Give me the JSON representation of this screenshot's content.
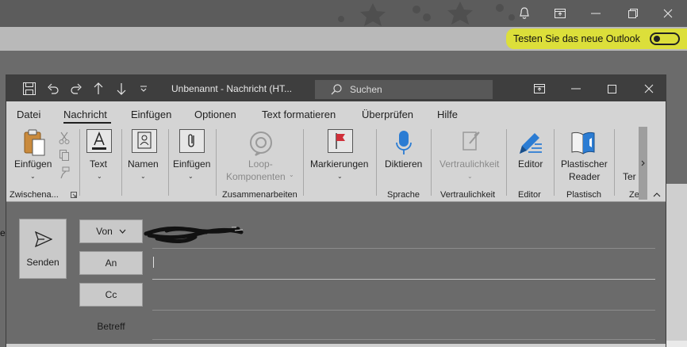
{
  "background_window": {
    "promo_text": "Testen Sie das neue Outlook",
    "left_clipped_char": "e"
  },
  "compose": {
    "title": "Unbenannt  -  Nachricht (HT...",
    "search_placeholder": "Suchen",
    "tabs": [
      {
        "label": "Datei"
      },
      {
        "label": "Nachricht",
        "active": true
      },
      {
        "label": "Einfügen"
      },
      {
        "label": "Optionen"
      },
      {
        "label": "Text formatieren"
      },
      {
        "label": "Überprüfen"
      },
      {
        "label": "Hilfe"
      }
    ],
    "ribbon": {
      "paste": "Einfügen",
      "text": "Text",
      "names": "Namen",
      "insert": "Einfügen",
      "loop_line1": "Loop-",
      "loop_line2": "Komponenten",
      "tags": "Markierungen",
      "dictate": "Diktieren",
      "sensitivity": "Vertraulichkeit",
      "editor": "Editor",
      "reader_line1": "Plastischer",
      "reader_line2": "Reader",
      "templates_clipped": "Ter",
      "groups": {
        "clipboard": "Zwischena...",
        "collaborate": "Zusammenarbeiten",
        "voice": "Sprache",
        "sensitivity": "Vertraulichkeit",
        "editor": "Editor",
        "immersive": "Plastisch",
        "clipped": "Ze"
      }
    },
    "fields": {
      "send": "Senden",
      "from": "Von",
      "to": "An",
      "cc": "Cc",
      "subject": "Betreff"
    }
  },
  "colors": {
    "highlight": "#dcdf3a",
    "titlebar": "#3e3e3e",
    "ribbon": "#d4d4d4",
    "flag_red": "#d0303a",
    "dictate_blue": "#2b7cd3"
  }
}
